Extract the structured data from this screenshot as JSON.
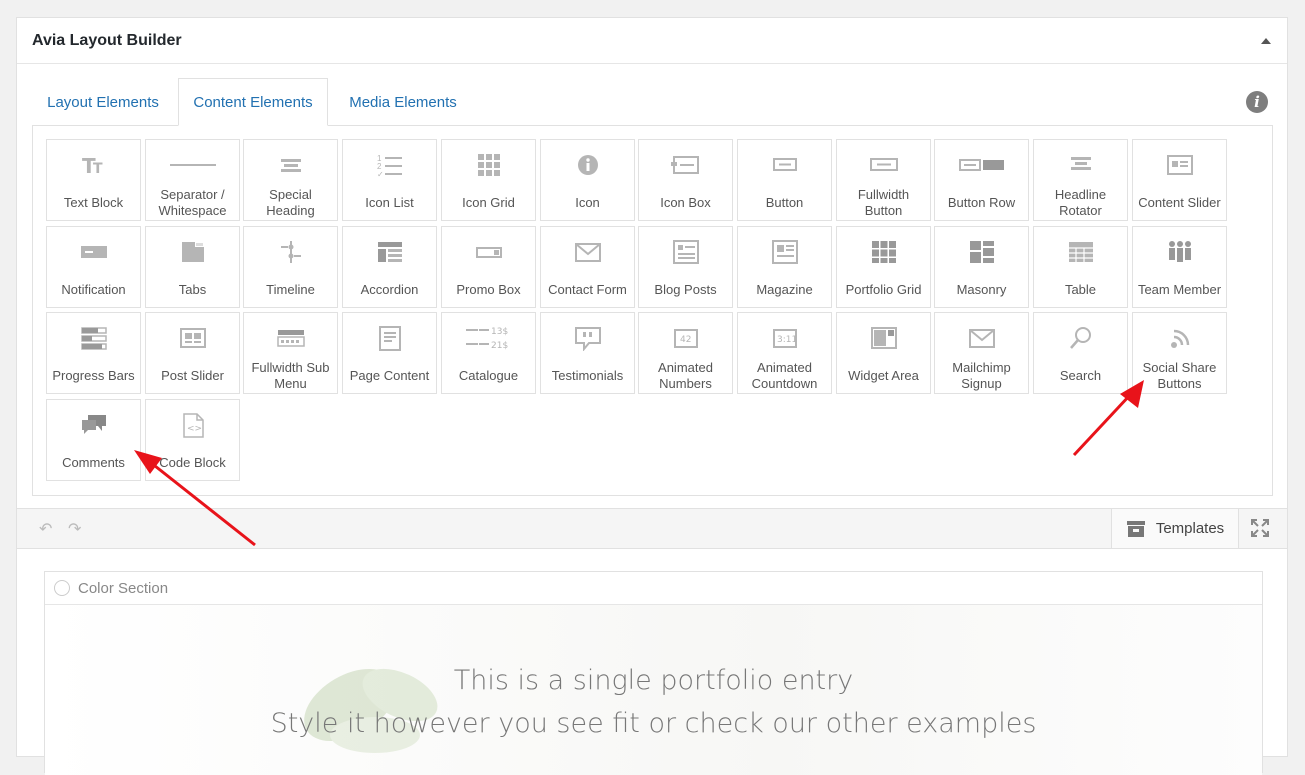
{
  "panel": {
    "title": "Avia Layout Builder"
  },
  "tabs": [
    {
      "label": "Layout Elements"
    },
    {
      "label": "Content Elements"
    },
    {
      "label": "Media Elements"
    }
  ],
  "tiles": [
    {
      "label": "Text Block",
      "icon": "text-block-icon"
    },
    {
      "label": "Separator / Whitespace",
      "icon": "separator-icon"
    },
    {
      "label": "Special Heading",
      "icon": "special-heading-icon"
    },
    {
      "label": "Icon List",
      "icon": "icon-list-icon"
    },
    {
      "label": "Icon Grid",
      "icon": "icon-grid-icon"
    },
    {
      "label": "Icon",
      "icon": "info-circle-icon"
    },
    {
      "label": "Icon Box",
      "icon": "icon-box-icon"
    },
    {
      "label": "Button",
      "icon": "button-icon"
    },
    {
      "label": "Fullwidth Button",
      "icon": "fullwidth-button-icon"
    },
    {
      "label": "Button Row",
      "icon": "button-row-icon"
    },
    {
      "label": "Headline Rotator",
      "icon": "headline-rotator-icon"
    },
    {
      "label": "Content Slider",
      "icon": "content-slider-icon"
    },
    {
      "label": "Notification",
      "icon": "notification-icon"
    },
    {
      "label": "Tabs",
      "icon": "tabs-icon"
    },
    {
      "label": "Timeline",
      "icon": "timeline-icon"
    },
    {
      "label": "Accordion",
      "icon": "accordion-icon"
    },
    {
      "label": "Promo Box",
      "icon": "promo-box-icon"
    },
    {
      "label": "Contact Form",
      "icon": "envelope-icon"
    },
    {
      "label": "Blog Posts",
      "icon": "blog-posts-icon"
    },
    {
      "label": "Magazine",
      "icon": "magazine-icon"
    },
    {
      "label": "Portfolio Grid",
      "icon": "portfolio-grid-icon"
    },
    {
      "label": "Masonry",
      "icon": "masonry-icon"
    },
    {
      "label": "Table",
      "icon": "table-icon"
    },
    {
      "label": "Team Member",
      "icon": "team-member-icon"
    },
    {
      "label": "Progress Bars",
      "icon": "progress-bars-icon"
    },
    {
      "label": "Post Slider",
      "icon": "post-slider-icon"
    },
    {
      "label": "Fullwidth Sub Menu",
      "icon": "submenu-icon"
    },
    {
      "label": "Page Content",
      "icon": "page-content-icon"
    },
    {
      "label": "Catalogue",
      "icon": "catalogue-icon"
    },
    {
      "label": "Testimonials",
      "icon": "testimonials-icon"
    },
    {
      "label": "Animated Numbers",
      "icon": "animated-numbers-icon"
    },
    {
      "label": "Animated Countdown",
      "icon": "countdown-icon"
    },
    {
      "label": "Widget Area",
      "icon": "widget-area-icon"
    },
    {
      "label": "Mailchimp Signup",
      "icon": "envelope-icon"
    },
    {
      "label": "Search",
      "icon": "search-icon"
    },
    {
      "label": "Social Share Buttons",
      "icon": "social-share-icon"
    },
    {
      "label": "Comments",
      "icon": "comments-icon"
    },
    {
      "label": "Code Block",
      "icon": "code-block-icon"
    }
  ],
  "icon_glyphs": {
    "catalogue_row1_price": "13$",
    "catalogue_row2_price": "21$",
    "animated_numbers": "42",
    "countdown": "3:11"
  },
  "toolbar": {
    "templates_label": "Templates"
  },
  "canvas": {
    "section_title": "Color Section",
    "hero_line1": "This is a single portfolio entry",
    "hero_line2": "Style it however you see fit or check our other examples"
  },
  "colors": {
    "link": "#2271b1",
    "icon": "#b5b5b5",
    "arrow": "#e8131a"
  }
}
